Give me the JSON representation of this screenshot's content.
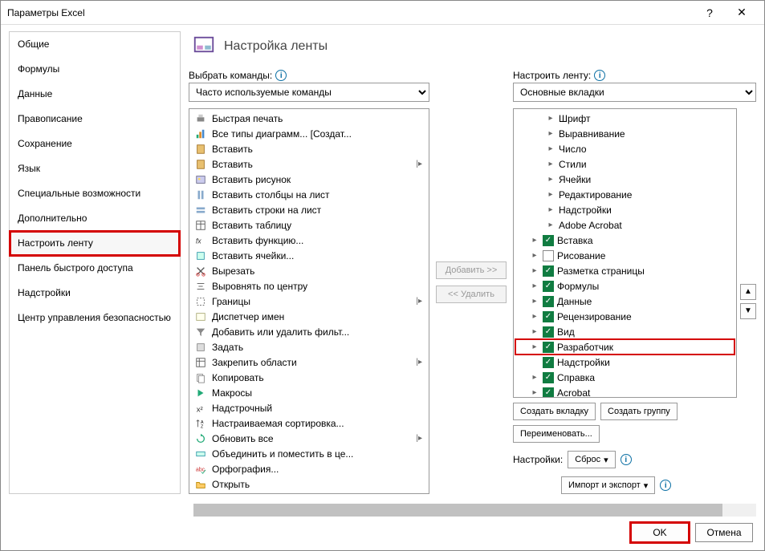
{
  "window": {
    "title": "Параметры Excel"
  },
  "sidebar": {
    "items": [
      "Общие",
      "Формулы",
      "Данные",
      "Правописание",
      "Сохранение",
      "Язык",
      "Специальные возможности",
      "Дополнительно",
      "Настроить ленту",
      "Панель быстрого доступа",
      "Надстройки",
      "Центр управления безопасностью"
    ],
    "selected_index": 8
  },
  "header": {
    "title": "Настройка ленты"
  },
  "left": {
    "label": "Выбрать команды:",
    "combo": "Часто используемые команды",
    "commands": [
      {
        "label": "Быстрая печать",
        "icon": "print"
      },
      {
        "label": "Все типы диаграмм... [Создат...",
        "icon": "chart"
      },
      {
        "label": "Вставить",
        "icon": "paste"
      },
      {
        "label": "Вставить",
        "icon": "paste",
        "expand": true
      },
      {
        "label": "Вставить рисунок",
        "icon": "image"
      },
      {
        "label": "Вставить столбцы на лист",
        "icon": "cols"
      },
      {
        "label": "Вставить строки на лист",
        "icon": "rows"
      },
      {
        "label": "Вставить таблицу",
        "icon": "table"
      },
      {
        "label": "Вставить функцию...",
        "icon": "fx"
      },
      {
        "label": "Вставить ячейки...",
        "icon": "cells"
      },
      {
        "label": "Вырезать",
        "icon": "cut"
      },
      {
        "label": "Выровнять по центру",
        "icon": "center"
      },
      {
        "label": "Границы",
        "icon": "border",
        "expand": true
      },
      {
        "label": "Диспетчер имен",
        "icon": "names"
      },
      {
        "label": "Добавить или удалить фильт...",
        "icon": "filter"
      },
      {
        "label": "Задать",
        "icon": "set"
      },
      {
        "label": "Закрепить области",
        "icon": "freeze",
        "expand": true
      },
      {
        "label": "Копировать",
        "icon": "copy"
      },
      {
        "label": "Макросы",
        "icon": "macro"
      },
      {
        "label": "Надстрочный",
        "icon": "super"
      },
      {
        "label": "Настраиваемая сортировка...",
        "icon": "sort"
      },
      {
        "label": "Обновить все",
        "icon": "refresh",
        "expand": true
      },
      {
        "label": "Объединить и поместить в це...",
        "icon": "merge"
      },
      {
        "label": "Орфография...",
        "icon": "spell"
      },
      {
        "label": "Открыть",
        "icon": "open"
      }
    ]
  },
  "mid": {
    "add": "Добавить >>",
    "remove": "<< Удалить"
  },
  "right": {
    "label": "Настроить ленту:",
    "combo": "Основные вкладки",
    "tree": [
      {
        "indent": 2,
        "label": "Шрифт",
        "expand": ">"
      },
      {
        "indent": 2,
        "label": "Выравнивание",
        "expand": ">"
      },
      {
        "indent": 2,
        "label": "Число",
        "expand": ">"
      },
      {
        "indent": 2,
        "label": "Стили",
        "expand": ">"
      },
      {
        "indent": 2,
        "label": "Ячейки",
        "expand": ">"
      },
      {
        "indent": 2,
        "label": "Редактирование",
        "expand": ">"
      },
      {
        "indent": 2,
        "label": "Надстройки",
        "expand": ">"
      },
      {
        "indent": 2,
        "label": "Adobe Acrobat",
        "expand": ">"
      },
      {
        "indent": 1,
        "label": "Вставка",
        "expand": ">",
        "checked": true
      },
      {
        "indent": 1,
        "label": "Рисование",
        "expand": ">",
        "checked": false
      },
      {
        "indent": 1,
        "label": "Разметка страницы",
        "expand": ">",
        "checked": true
      },
      {
        "indent": 1,
        "label": "Формулы",
        "expand": ">",
        "checked": true
      },
      {
        "indent": 1,
        "label": "Данные",
        "expand": ">",
        "checked": true
      },
      {
        "indent": 1,
        "label": "Рецензирование",
        "expand": ">",
        "checked": true
      },
      {
        "indent": 1,
        "label": "Вид",
        "expand": ">",
        "checked": true
      },
      {
        "indent": 1,
        "label": "Разработчик",
        "expand": ">",
        "checked": true,
        "highlight": true
      },
      {
        "indent": 1,
        "label": "Надстройки",
        "expand": "",
        "checked": true
      },
      {
        "indent": 1,
        "label": "Справка",
        "expand": ">",
        "checked": true
      },
      {
        "indent": 1,
        "label": "Acrobat",
        "expand": ">",
        "checked": true
      }
    ],
    "toolbar": {
      "new_tab": "Создать вкладку",
      "new_group": "Создать группу",
      "rename": "Переименовать...",
      "settings_label": "Настройки:",
      "reset": "Сброс",
      "import_export": "Импорт и экспорт"
    }
  },
  "footer": {
    "ok": "OK",
    "cancel": "Отмена"
  }
}
